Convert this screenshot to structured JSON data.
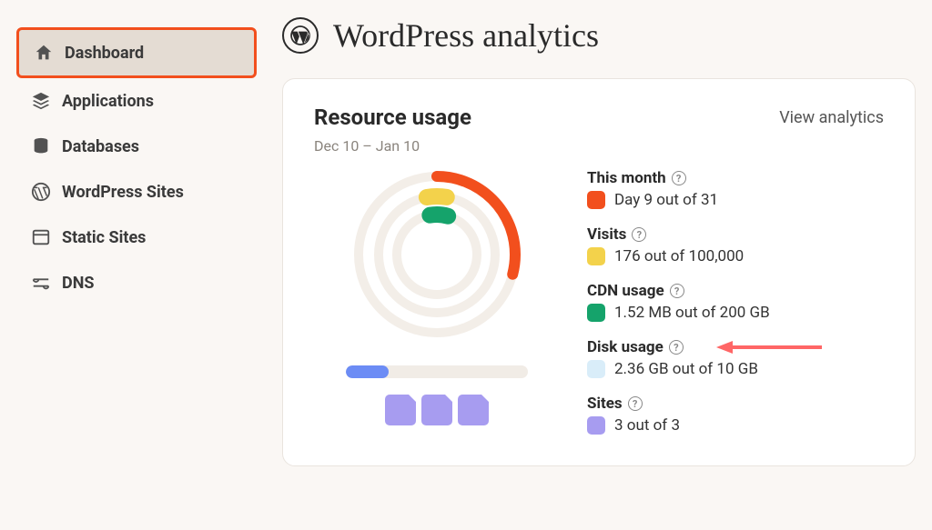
{
  "sidebar": {
    "items": [
      {
        "label": "Dashboard"
      },
      {
        "label": "Applications"
      },
      {
        "label": "Databases"
      },
      {
        "label": "WordPress Sites"
      },
      {
        "label": "Static Sites"
      },
      {
        "label": "DNS"
      }
    ]
  },
  "header": {
    "title": "WordPress analytics"
  },
  "card": {
    "title": "Resource usage",
    "view_link": "View analytics",
    "date_range": "Dec 10 – Jan 10"
  },
  "stats": {
    "month": {
      "label": "This month",
      "value": "Day 9 out of 31",
      "swatch": "#f24f1d"
    },
    "visits": {
      "label": "Visits",
      "value": "176 out of 100,000",
      "swatch": "#f3d24b"
    },
    "cdn": {
      "label": "CDN usage",
      "value": "1.52 MB out of 200 GB",
      "swatch": "#15a36b"
    },
    "disk": {
      "label": "Disk usage",
      "value": "2.36 GB out of 10 GB",
      "swatch": "#d9edf9"
    },
    "sites": {
      "label": "Sites",
      "value": "3 out of 3",
      "swatch": "#a79cf0"
    }
  },
  "chart_data": {
    "type": "pie",
    "title": "Resource usage",
    "rings": [
      {
        "name": "This month",
        "value": 9,
        "max": 31,
        "color": "#f24f1d"
      },
      {
        "name": "Visits",
        "value": 176,
        "max": 100000,
        "color": "#f3d24b"
      },
      {
        "name": "CDN usage",
        "value_label": "1.52 MB",
        "max_label": "200 GB",
        "fraction": 7.6e-06,
        "color": "#15a36b"
      }
    ],
    "disk_bar": {
      "value_label": "2.36 GB",
      "max_label": "10 GB",
      "fraction": 0.236,
      "color": "#6c8cf5"
    },
    "sites": {
      "value": 3,
      "max": 3,
      "color": "#a79cf0"
    }
  }
}
